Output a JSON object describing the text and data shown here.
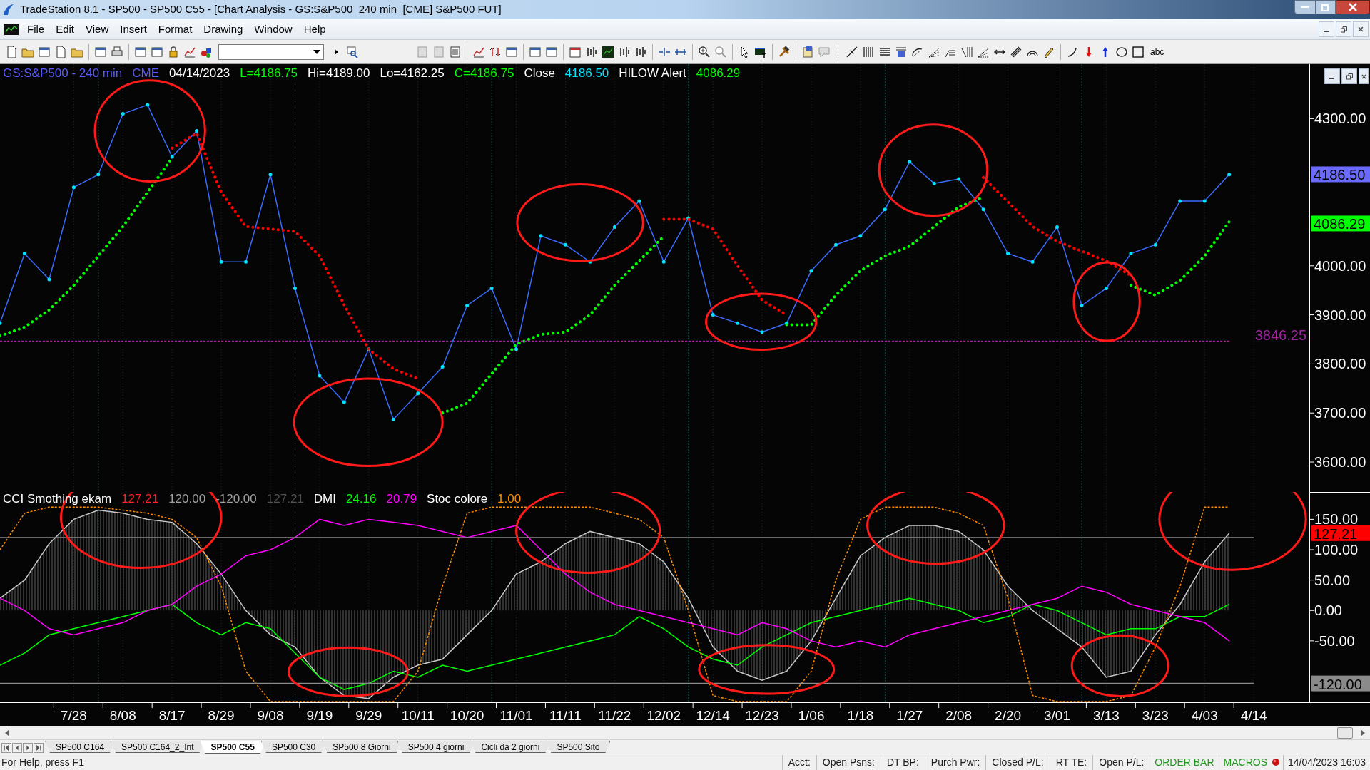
{
  "window": {
    "title": "TradeStation 8.1 - SP500 - SP500 C55 - [Chart Analysis - GS:S&P500  240 min  [CME] S&P500 FUT]"
  },
  "menu": [
    "File",
    "Edit",
    "View",
    "Insert",
    "Format",
    "Drawing",
    "Window",
    "Help"
  ],
  "toolbar": {
    "text_tool": "abc"
  },
  "price_panel": {
    "legend": [
      {
        "text": "GS:S&P500 - 240 min",
        "color": "#5a5aff"
      },
      {
        "text": "CME",
        "color": "#5a5aff"
      },
      {
        "text": "04/14/2023",
        "color": "#ffffff"
      },
      {
        "text": "L=4186.75",
        "color": "#00ff00"
      },
      {
        "text": "Hi=4189.00",
        "color": "#ffffff"
      },
      {
        "text": "Lo=4162.25",
        "color": "#ffffff"
      },
      {
        "text": "C=4186.75",
        "color": "#00ff00"
      },
      {
        "text": "Close",
        "color": "#ffffff"
      },
      {
        "text": "4186.50",
        "color": "#00e5ff"
      },
      {
        "text": "HILOW Alert",
        "color": "#ffffff"
      },
      {
        "text": "4086.29",
        "color": "#00ff00"
      }
    ],
    "tags": [
      {
        "label": "4186.50",
        "color": "#6a6aff"
      },
      {
        "label": "4086.29",
        "color": "#00ff00"
      }
    ],
    "level_label": "3846.25",
    "chart_data": {
      "type": "line",
      "grid": true,
      "categories": [
        null,
        null,
        null,
        null,
        null,
        null,
        null,
        null,
        null,
        null,
        null,
        null,
        null,
        null,
        null,
        null,
        null,
        null,
        null,
        null,
        null,
        null,
        null,
        null,
        null,
        null,
        null,
        null,
        null,
        null,
        null,
        null,
        null,
        null,
        null,
        null,
        null,
        null,
        null,
        null,
        null,
        null,
        null,
        null,
        null,
        null,
        null,
        null,
        null,
        null,
        null
      ],
      "series": [
        {
          "color": "#3a6cff",
          "values": [
            3883,
            4025,
            3972,
            4160,
            4186,
            4310,
            4328,
            4222,
            4275,
            4008,
            4008,
            4186,
            3954,
            3776,
            3722,
            3830,
            3687,
            3740,
            3794,
            3919,
            3954,
            3830,
            4061,
            4043,
            4008,
            4079,
            4132,
            4008,
            4097,
            3900,
            3883,
            3865,
            3883,
            3990,
            4043,
            4061,
            4115,
            4212,
            4168,
            4177,
            4115,
            4025,
            4008,
            4079,
            3919,
            3954,
            4025,
            4043,
            4132,
            4132,
            4186
          ]
        },
        {
          "color": "#00ff00",
          "line_style": "dotted",
          "values": [
            3857,
            3875,
            3910,
            3960,
            4020,
            4080,
            4150,
            4220,
            null,
            null,
            null,
            null,
            null,
            null,
            null,
            null,
            null,
            null,
            3700,
            3720,
            3780,
            3840,
            3860,
            3865,
            3900,
            3960,
            4010,
            4060,
            null,
            null,
            null,
            null,
            3880,
            3880,
            3940,
            3990,
            4020,
            4040,
            4080,
            4120,
            4140,
            null,
            null,
            null,
            null,
            null,
            3960,
            3940,
            3970,
            4020,
            4090
          ]
        },
        {
          "color": "#ff0000",
          "line_style": "dotted",
          "values": [
            null,
            null,
            null,
            null,
            null,
            null,
            null,
            4240,
            4270,
            4150,
            4080,
            4075,
            4070,
            4020,
            3920,
            3830,
            3790,
            3770,
            null,
            null,
            null,
            null,
            null,
            null,
            null,
            null,
            null,
            4095,
            4095,
            4075,
            4000,
            3930,
            3900,
            null,
            null,
            null,
            null,
            null,
            null,
            null,
            4180,
            4130,
            4080,
            4050,
            4030,
            4010,
            3980,
            null,
            null,
            null,
            null
          ]
        },
        {
          "color": "#a020a0",
          "line_style": "dashed",
          "values": [
            3846.25,
            3846.25,
            3846.25,
            3846.25,
            3846.25,
            3846.25,
            3846.25,
            3846.25,
            3846.25,
            3846.25,
            3846.25,
            3846.25,
            3846.25,
            3846.25,
            3846.25,
            3846.25,
            3846.25,
            3846.25,
            3846.25,
            3846.25,
            3846.25,
            3846.25,
            3846.25,
            3846.25,
            3846.25,
            3846.25,
            3846.25,
            3846.25,
            3846.25,
            3846.25,
            3846.25,
            3846.25,
            3846.25,
            3846.25,
            3846.25,
            3846.25,
            3846.25,
            3846.25,
            3846.25,
            3846.25,
            3846.25,
            3846.25,
            3846.25,
            3846.25,
            3846.25,
            3846.25,
            3846.25,
            3846.25,
            3846.25,
            3846.25,
            3846.25
          ]
        }
      ],
      "ylim": [
        3539,
        4411
      ],
      "yticks": [
        {
          "value": 3600,
          "label": "3600.00"
        },
        {
          "value": 3700,
          "label": "3700.00"
        },
        {
          "value": 3800,
          "label": "3800.00"
        },
        {
          "value": 3900,
          "label": "3900.00"
        },
        {
          "value": 4000,
          "label": "4000.00"
        },
        {
          "value": 4300,
          "label": "4300.00"
        }
      ]
    }
  },
  "indicator_panel": {
    "legend": [
      {
        "text": "CCI Smothing ekam",
        "color": "#ffffff"
      },
      {
        "text": "127.21",
        "color": "#ff2020"
      },
      {
        "text": "120.00",
        "color": "#a0a0a0"
      },
      {
        "text": "-120.00",
        "color": "#a0a0a0"
      },
      {
        "text": "127.21",
        "color": "#505050"
      },
      {
        "text": "DMI",
        "color": "#ffffff"
      },
      {
        "text": "24.16",
        "color": "#00ff00"
      },
      {
        "text": "20.79",
        "color": "#ff00ff"
      },
      {
        "text": "Stoc colore",
        "color": "#ffffff"
      },
      {
        "text": "1.00",
        "color": "#ff8c00"
      }
    ],
    "tags": [
      {
        "label": "127.21",
        "color": "#ff0000"
      },
      {
        "label": "-120.00",
        "color": "#8a8a8a"
      }
    ],
    "chart_data": {
      "type": "line",
      "grid": true,
      "categories": [
        null,
        null,
        null,
        "7/28",
        null,
        "8/08",
        null,
        "8/17",
        null,
        "8/29",
        null,
        "9/08",
        null,
        "9/19",
        null,
        "9/29",
        null,
        "10/11",
        null,
        "10/20",
        null,
        "11/01",
        null,
        "11/11",
        null,
        "11/22",
        null,
        "12/02",
        null,
        "12/14",
        null,
        "12/23",
        null,
        "1/06",
        null,
        "1/18",
        null,
        "1/27",
        null,
        "2/08",
        null,
        "2/20",
        null,
        "3/01",
        null,
        "3/13",
        null,
        "3/23",
        null,
        "4/03",
        null,
        "4/14"
      ],
      "series": [
        {
          "color": "#c8c8c8",
          "type": "area",
          "values": [
            20,
            50,
            110,
            150,
            165,
            160,
            150,
            145,
            110,
            60,
            0,
            -40,
            -60,
            -110,
            -140,
            -145,
            -110,
            -90,
            -80,
            -40,
            0,
            60,
            80,
            110,
            130,
            120,
            110,
            80,
            20,
            -60,
            -100,
            -115,
            -100,
            -50,
            20,
            90,
            120,
            140,
            140,
            130,
            100,
            40,
            0,
            -30,
            -60,
            -110,
            -100,
            -40,
            10,
            80,
            127,
            null
          ]
        },
        {
          "color": "#00ff00",
          "values": [
            -90,
            -70,
            -40,
            -30,
            -20,
            -10,
            0,
            10,
            -20,
            -40,
            -20,
            -30,
            -70,
            -110,
            -130,
            -120,
            -100,
            -110,
            -90,
            -100,
            -90,
            -80,
            -70,
            -60,
            -50,
            -40,
            -10,
            -30,
            -60,
            -80,
            -90,
            -60,
            -40,
            -20,
            -10,
            0,
            10,
            20,
            10,
            0,
            -20,
            -10,
            10,
            0,
            -20,
            -40,
            -30,
            -30,
            -10,
            -10,
            10,
            null
          ]
        },
        {
          "color": "#ff00ff",
          "values": [
            20,
            0,
            -30,
            -40,
            -30,
            -20,
            0,
            10,
            40,
            60,
            90,
            100,
            120,
            150,
            140,
            150,
            145,
            140,
            130,
            120,
            130,
            140,
            100,
            60,
            30,
            10,
            0,
            -10,
            -20,
            -30,
            -40,
            -20,
            -30,
            -50,
            -60,
            -50,
            -60,
            -40,
            -30,
            -20,
            -10,
            0,
            10,
            20,
            40,
            30,
            10,
            0,
            -10,
            -20,
            -50,
            null
          ]
        },
        {
          "color": "#ff8c00",
          "line_style": "dashed",
          "values": [
            100,
            160,
            170,
            170,
            170,
            165,
            160,
            150,
            120,
            40,
            -100,
            -150,
            -150,
            -150,
            -150,
            -150,
            -150,
            -100,
            40,
            160,
            170,
            170,
            170,
            170,
            170,
            160,
            150,
            120,
            0,
            -140,
            -150,
            -150,
            -150,
            -100,
            50,
            150,
            170,
            170,
            170,
            160,
            140,
            20,
            -140,
            -150,
            -150,
            -150,
            -140,
            -60,
            40,
            170,
            170,
            null
          ]
        },
        {
          "color": "#8a8a8a",
          "values": [
            120,
            120,
            120,
            120,
            120,
            120,
            120,
            120,
            120,
            120,
            120,
            120,
            120,
            120,
            120,
            120,
            120,
            120,
            120,
            120,
            120,
            120,
            120,
            120,
            120,
            120,
            120,
            120,
            120,
            120,
            120,
            120,
            120,
            120,
            120,
            120,
            120,
            120,
            120,
            120,
            120,
            120,
            120,
            120,
            120,
            120,
            120,
            120,
            120,
            120,
            120,
            120
          ]
        },
        {
          "color": "#8a8a8a",
          "values": [
            -120,
            -120,
            -120,
            -120,
            -120,
            -120,
            -120,
            -120,
            -120,
            -120,
            -120,
            -120,
            -120,
            -120,
            -120,
            -120,
            -120,
            -120,
            -120,
            -120,
            -120,
            -120,
            -120,
            -120,
            -120,
            -120,
            -120,
            -120,
            -120,
            -120,
            -120,
            -120,
            -120,
            -120,
            -120,
            -120,
            -120,
            -120,
            -120,
            -120,
            -120,
            -120,
            -120,
            -120,
            -120,
            -120,
            -120,
            -120,
            -120,
            -120,
            -120,
            -120
          ]
        }
      ],
      "ylim": [
        -151,
        195
      ],
      "yticks": [
        {
          "value": -50,
          "label": "-50.00"
        },
        {
          "value": 0,
          "label": "0.00"
        },
        {
          "value": 50,
          "label": "50.00"
        },
        {
          "value": 100,
          "label": "100.00"
        },
        {
          "value": 150,
          "label": "150.00"
        }
      ]
    }
  },
  "sheet_tabs": [
    {
      "label": "SP500 C164",
      "selected": false
    },
    {
      "label": "SP500 C164_2_Int",
      "selected": false
    },
    {
      "label": "SP500 C55",
      "selected": true
    },
    {
      "label": "SP500 C30",
      "selected": false
    },
    {
      "label": "SP500 8 Giorni",
      "selected": false
    },
    {
      "label": "SP500 4 giorni",
      "selected": false
    },
    {
      "label": "Cicli da 2 giorni",
      "selected": false
    },
    {
      "label": "SP500 Sito",
      "selected": false
    }
  ],
  "status_bar": {
    "help": "For Help, press F1",
    "fields": [
      "Acct:",
      "Open Psns:",
      "DT BP:",
      "Purch Pwr:",
      "Closed P/L:",
      "RT TE:",
      "Open P/L:"
    ],
    "order_bar": "ORDER BAR",
    "macros": "MACROS",
    "datetime": "14/04/2023 16:03"
  }
}
